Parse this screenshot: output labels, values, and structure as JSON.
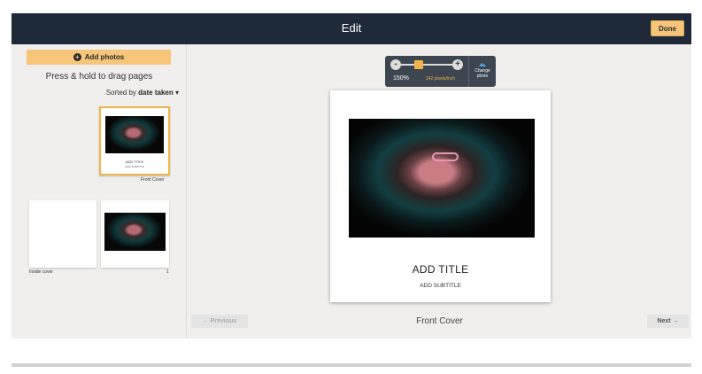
{
  "header": {
    "title": "Edit",
    "done_label": "Done"
  },
  "sidebar": {
    "add_photos_label": "Add photos",
    "drag_hint": "Press & hold to drag pages",
    "sort_prefix": "Sorted by",
    "sort_value": "date taken",
    "thumbnails": [
      {
        "caption": "Front Cover",
        "mini_title": "ADD TITLE",
        "mini_subtitle": "ADD SUBTITLE"
      },
      {
        "caption": "Inside cover"
      },
      {
        "caption": "1"
      }
    ]
  },
  "zoom": {
    "percent_label": "150%",
    "ppi_label": "242 pixels/inch",
    "level": 0.35,
    "minus": "-",
    "plus": "+"
  },
  "change_photo_label": "Change photo",
  "page": {
    "title": "ADD TITLE",
    "subtitle": "ADD SUBTITLE",
    "label": "Front Cover"
  },
  "nav": {
    "previous_label": "← Previous",
    "next_label": "Next →"
  },
  "colors": {
    "header_bg": "#1e2a38",
    "accent": "#f7c67a",
    "selected_border": "#f2b44a"
  }
}
